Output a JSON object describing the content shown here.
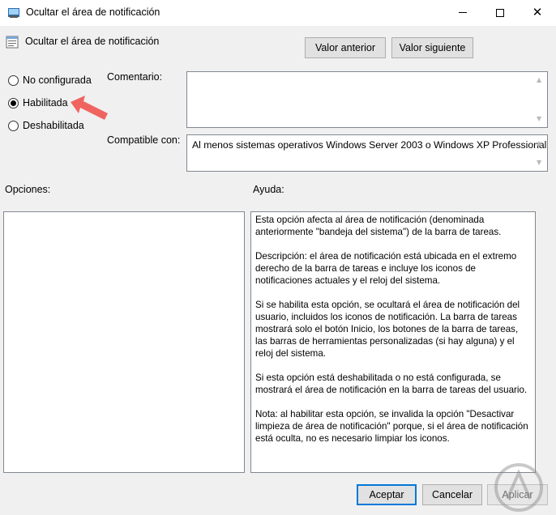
{
  "window": {
    "title": "Ocultar el área de notificación",
    "app_icon": "policy-icon",
    "controls": [
      "minimize-icon",
      "maximize-icon",
      "close-icon"
    ]
  },
  "header": {
    "title": "Ocultar el área de notificación",
    "icon": "setting-icon",
    "prev_label": "Valor anterior",
    "next_label": "Valor siguiente"
  },
  "state": {
    "options": [
      {
        "label": "No configurada",
        "checked": false
      },
      {
        "label": "Habilitada",
        "checked": true
      },
      {
        "label": "Deshabilitada",
        "checked": false
      }
    ]
  },
  "comment": {
    "label": "Comentario:",
    "value": ""
  },
  "compatible": {
    "label": "Compatible con:",
    "value": "Al menos sistemas operativos Windows Server 2003 o Windows XP Professional"
  },
  "panels": {
    "options_label": "Opciones:",
    "help_label": "Ayuda:"
  },
  "help": {
    "paragraphs": [
      "Esta opción afecta al área de notificación (denominada anteriormente \"bandeja del sistema\") de la barra de tareas.",
      "Descripción: el área de notificación está ubicada en el extremo derecho de la barra de tareas e incluye los iconos de notificaciones actuales y el reloj del sistema.",
      "Si se habilita esta opción, se ocultará el área de notificación del usuario, incluidos los iconos de notificación. La barra de tareas mostrará solo el botón Inicio, los botones de la barra de tareas, las barras de herramientas personalizadas (si hay alguna) y el reloj del sistema.",
      "Si esta opción está deshabilitada o no está configurada, se mostrará el área de notificación en la barra de tareas del usuario.",
      "Nota: al habilitar esta opción, se invalida la opción \"Desactivar limpieza de área de notificación\" porque, si el área de notificación está oculta, no es necesario limpiar los iconos."
    ]
  },
  "footer": {
    "ok_label": "Aceptar",
    "cancel_label": "Cancelar",
    "apply_label": "Aplicar"
  },
  "colors": {
    "accent": "#0078d7",
    "arrow": "#f0645f"
  }
}
